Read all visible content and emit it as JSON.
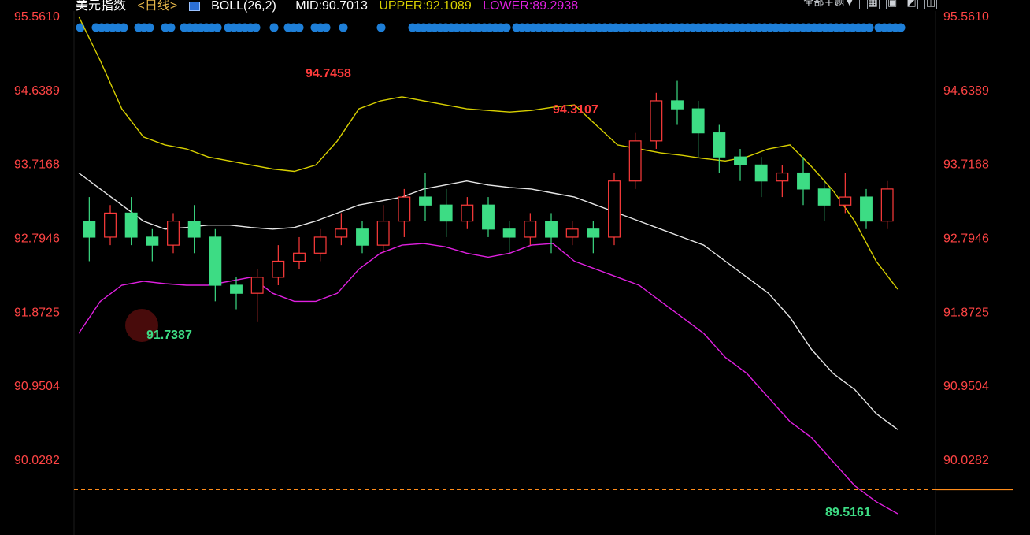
{
  "header": {
    "title": "美元指数",
    "period": "<日线>",
    "boll_label": "BOLL(26,2)",
    "mid": "MID:90.7013",
    "upper": "UPPER:92.1089",
    "lower": "LOWER:89.2938"
  },
  "controls": {
    "subject_button": "全部主题▼"
  },
  "colors": {
    "background": "#000000",
    "up_candle": "#ff3b3b",
    "down_candle": "#3ddc84",
    "mid_line": "#e6e6e6",
    "upper_line": "#d8d000",
    "lower_line": "#e020e0",
    "axis_text": "#ff4444",
    "current_price_line": "#ff8c1a",
    "event_dot": "#1e7fd8"
  },
  "chart_data": {
    "type": "candlestick",
    "title": "美元指数",
    "y_ticks": [
      95.561,
      94.6389,
      93.7168,
      92.7946,
      91.8725,
      90.9504,
      90.0282
    ],
    "y_tick_labels": [
      "95.5610",
      "94.6389",
      "93.7168",
      "92.7946",
      "91.8725",
      "90.9504",
      "90.0282"
    ],
    "ylim": [
      89.0,
      95.561
    ],
    "annotations": {
      "high_1": {
        "label": "94.7458",
        "value": 94.7458
      },
      "high_2": {
        "label": "94.3107",
        "value": 94.3107
      },
      "low_1": {
        "label": "91.7387",
        "value": 91.7387
      },
      "low_2": {
        "label": "89.5161",
        "value": 89.5161
      }
    },
    "current_price": 89.65,
    "bands": {
      "upper": [
        95.55,
        95.0,
        94.4,
        94.05,
        93.95,
        93.9,
        93.8,
        93.75,
        93.7,
        93.65,
        93.62,
        93.7,
        94.0,
        94.4,
        94.5,
        94.55,
        94.5,
        94.45,
        94.4,
        94.38,
        94.36,
        94.38,
        94.42,
        94.45,
        94.2,
        93.95,
        93.9,
        93.85,
        93.82,
        93.78,
        93.75,
        93.8,
        93.9,
        93.95,
        93.68,
        93.38,
        93.0,
        92.5,
        92.15
      ],
      "mid": [
        93.6,
        93.4,
        93.2,
        93.0,
        92.9,
        92.92,
        92.95,
        92.95,
        92.92,
        92.9,
        92.92,
        93.0,
        93.1,
        93.2,
        93.25,
        93.3,
        93.4,
        93.45,
        93.5,
        93.45,
        93.42,
        93.4,
        93.35,
        93.3,
        93.2,
        93.1,
        93.0,
        92.9,
        92.8,
        92.7,
        92.5,
        92.3,
        92.1,
        91.8,
        91.4,
        91.1,
        90.9,
        90.6,
        90.4
      ],
      "lower": [
        91.6,
        92.0,
        92.2,
        92.25,
        92.22,
        92.2,
        92.2,
        92.25,
        92.3,
        92.1,
        92.0,
        92.0,
        92.1,
        92.4,
        92.6,
        92.7,
        92.72,
        92.68,
        92.6,
        92.55,
        92.6,
        92.7,
        92.72,
        92.5,
        92.4,
        92.3,
        92.2,
        92.0,
        91.8,
        91.6,
        91.3,
        91.1,
        90.8,
        90.5,
        90.3,
        90.0,
        89.7,
        89.5,
        89.35
      ]
    },
    "bands_x_count": 39,
    "candles": [
      [
        93.0,
        92.8,
        93.3,
        92.5
      ],
      [
        92.8,
        93.1,
        93.2,
        92.7
      ],
      [
        93.1,
        92.8,
        93.3,
        92.7
      ],
      [
        92.8,
        92.7,
        92.9,
        92.5
      ],
      [
        92.7,
        93.0,
        93.1,
        92.6
      ],
      [
        93.0,
        92.8,
        93.2,
        92.6
      ],
      [
        92.8,
        92.2,
        92.9,
        92.0
      ],
      [
        92.2,
        92.1,
        92.3,
        91.9
      ],
      [
        92.1,
        92.3,
        92.4,
        91.74
      ],
      [
        92.3,
        92.5,
        92.7,
        92.2
      ],
      [
        92.5,
        92.6,
        92.8,
        92.4
      ],
      [
        92.6,
        92.8,
        92.9,
        92.5
      ],
      [
        92.8,
        92.9,
        93.1,
        92.7
      ],
      [
        92.9,
        92.7,
        93.0,
        92.6
      ],
      [
        92.7,
        93.0,
        93.2,
        92.6
      ],
      [
        93.0,
        93.3,
        93.4,
        92.8
      ],
      [
        93.3,
        93.2,
        93.6,
        93.0
      ],
      [
        93.2,
        93.0,
        93.4,
        92.8
      ],
      [
        93.0,
        93.2,
        93.3,
        92.9
      ],
      [
        93.2,
        92.9,
        93.3,
        92.8
      ],
      [
        92.9,
        92.8,
        93.0,
        92.6
      ],
      [
        92.8,
        93.0,
        93.1,
        92.7
      ],
      [
        93.0,
        92.8,
        93.1,
        92.6
      ],
      [
        92.8,
        92.9,
        93.0,
        92.7
      ],
      [
        92.9,
        92.8,
        93.0,
        92.6
      ],
      [
        92.8,
        93.5,
        93.6,
        92.7
      ],
      [
        93.5,
        94.0,
        94.1,
        93.4
      ],
      [
        94.0,
        94.5,
        94.6,
        93.9
      ],
      [
        94.5,
        94.4,
        94.75,
        94.2
      ],
      [
        94.4,
        94.1,
        94.5,
        93.8
      ],
      [
        94.1,
        93.8,
        94.2,
        93.6
      ],
      [
        93.8,
        93.7,
        93.9,
        93.5
      ],
      [
        93.7,
        93.5,
        93.8,
        93.3
      ],
      [
        93.5,
        93.6,
        93.7,
        93.3
      ],
      [
        93.6,
        93.4,
        93.8,
        93.2
      ],
      [
        93.4,
        93.2,
        93.5,
        93.0
      ],
      [
        93.2,
        93.3,
        93.6,
        93.1
      ],
      [
        93.3,
        93.0,
        93.4,
        92.9
      ],
      [
        93.0,
        93.4,
        93.5,
        92.9
      ]
    ]
  }
}
